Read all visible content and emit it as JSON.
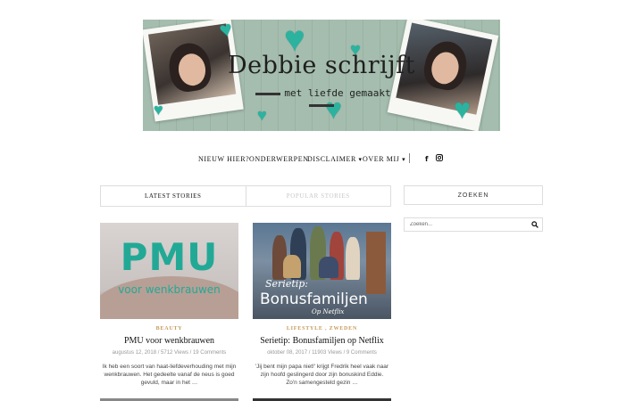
{
  "header": {
    "brand": "Debbie schrijft",
    "tagline": "met liefde gemaakt"
  },
  "nav": {
    "items": [
      {
        "label": "NIEUW HIER?"
      },
      {
        "label": "ONDERWERPEN"
      },
      {
        "label": "DISCLAIMER",
        "dropdown": true
      },
      {
        "label": "OVER MIJ",
        "dropdown": true
      }
    ],
    "social": [
      "facebook-icon",
      "instagram-icon"
    ]
  },
  "tabs": {
    "latest": "LATEST STORIES",
    "popular": "POPULAR STORIES"
  },
  "sidebar": {
    "search_title": "ZOEKEN",
    "search_placeholder": "Zoeken..."
  },
  "posts": [
    {
      "category": "BEAUTY",
      "title": "PMU voor wenkbrauwen",
      "meta": "augustus 12, 2018 / 5712 Views / 19 Comments",
      "excerpt": "Ik heb een soort van haat-liefdeverhouding met mijn wenkbrauwen. Het gedeelte vanaf de neus is goed gevuld, maar in het …",
      "image_text_main": "PMU",
      "image_text_sub": "voor wenkbrauwen"
    },
    {
      "category": "LIFESTYLE , ZWEDEN",
      "title": "Serietip: Bonusfamiljen op Netflix",
      "meta": "oktober 08, 2017 / 11903 Views / 9 Comments",
      "excerpt": "'Jij bent mijn papa niet!' krijgt Fredrik heel vaak naar zijn hoofd geslingerd door zijn bonuskind Eddie. Zo'n samengesteld gezin …",
      "image_text_1": "Serietip:",
      "image_text_2": "Bonusfamiljen",
      "image_text_3": "Op Netflix"
    }
  ],
  "colors": {
    "accent_teal": "#22a996",
    "category_gold": "#c59a5a",
    "banner_green": "#9fb9a9"
  }
}
